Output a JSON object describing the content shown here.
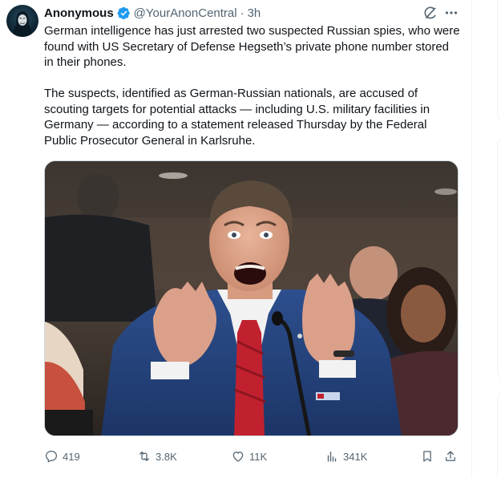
{
  "tweet": {
    "author": {
      "display_name": "Anonymous",
      "verified": true,
      "handle": "@YourAnonCentral",
      "separator": "·",
      "time": "3h"
    },
    "text": {
      "paragraph_1": "German intelligence has just arrested two suspected Russian spies, who were found with US Secretary of Defense Hegseth’s private phone number stored in their phones.",
      "paragraph_2": "The suspects, identified as German-Russian nationals, are accused of scouting targets for potential attacks — including U.S. military facilities in Germany — according to a statement released Thursday by the Federal Public Prosecutor General in Karlsruhe."
    },
    "actions": {
      "reply_count": "419",
      "repost_count": "3.8K",
      "like_count": "11K",
      "views_count": "341K"
    }
  },
  "icons": {
    "verified": "verified-badge-icon",
    "grok": "grok-icon",
    "more": "more-icon",
    "reply": "reply-icon",
    "repost": "repost-icon",
    "like": "heart-icon",
    "views": "analytics-icon",
    "bookmark": "bookmark-icon",
    "share": "share-icon"
  },
  "colors": {
    "text_primary": "#0f1419",
    "text_secondary": "#536471",
    "verified": "#1d9bf0",
    "border": "#cfd9de"
  }
}
